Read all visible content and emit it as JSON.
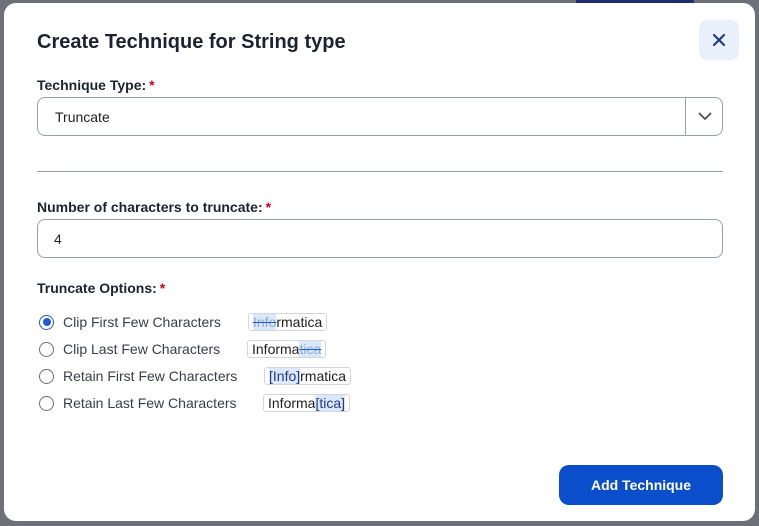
{
  "dialog": {
    "title": "Create Technique for String type"
  },
  "technique_type": {
    "label": "Technique Type:",
    "required_mark": "*",
    "selected": "Truncate"
  },
  "char_count": {
    "label": "Number of characters to truncate:",
    "required_mark": "*",
    "value": "4"
  },
  "options": {
    "label": "Truncate Options:",
    "required_mark": "*",
    "items": [
      {
        "label": "Clip First Few Characters",
        "checked": true,
        "example": {
          "pre": "",
          "mark": "Info",
          "post": "rmatica"
        }
      },
      {
        "label": "Clip Last Few Characters",
        "checked": false,
        "example": {
          "pre": "Informa",
          "mark": "tica",
          "post": ""
        }
      },
      {
        "label": "Retain First Few Characters",
        "checked": false,
        "example": {
          "pre": "",
          "mark": "[Info]",
          "post": "rmatica"
        }
      },
      {
        "label": "Retain Last Few Characters",
        "checked": false,
        "example": {
          "pre": "Informa",
          "mark": "[tica]",
          "post": ""
        }
      }
    ]
  },
  "actions": {
    "submit": "Add Technique"
  },
  "colors": {
    "primary": "#0b4ecb",
    "required": "#d0021b",
    "highlight": "#dbe7fb"
  }
}
